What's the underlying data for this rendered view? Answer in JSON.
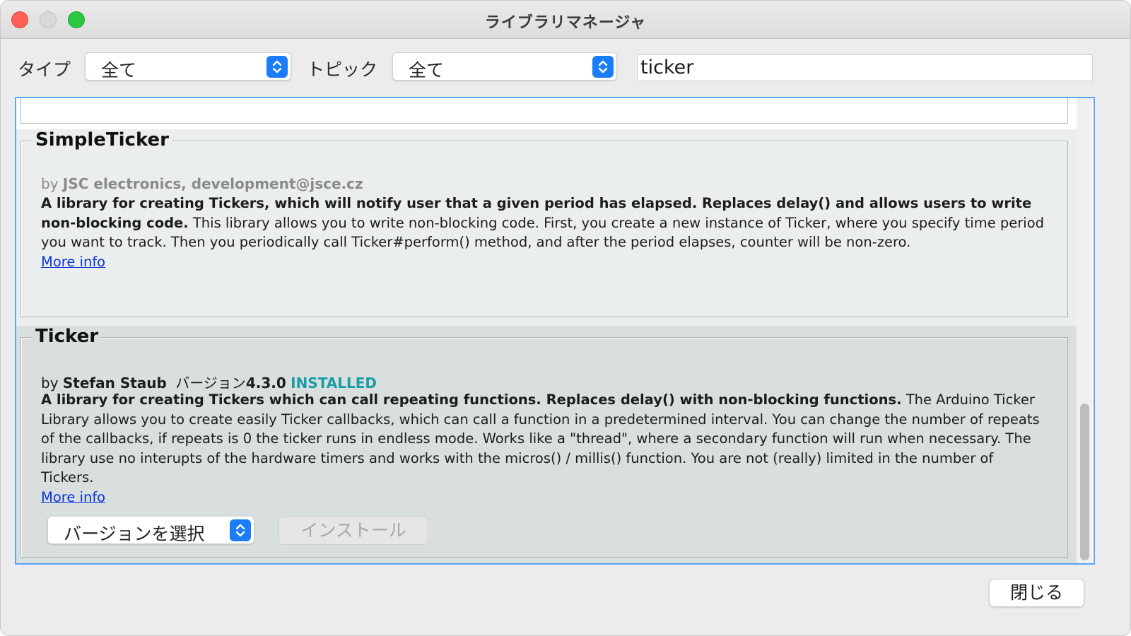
{
  "window": {
    "title": "ライブラリマネージャ"
  },
  "filters": {
    "type_label": "タイプ",
    "type_value": "全て",
    "topic_label": "トピック",
    "topic_value": "全て",
    "search_value": "ticker"
  },
  "libraries": [
    {
      "name": "SimpleTicker",
      "by_prefix": "by",
      "author": "JSC electronics, development@jsce.cz",
      "summary": "A library for creating Tickers, which will notify user that a given period has elapsed. Replaces delay() and allows users to write non-blocking code.",
      "description": "This library allows you to write non-blocking code. First, you create a new instance of Ticker, where you specify time period you want to track. Then you periodically call Ticker#perform() method, and after the period elapses, counter will be non-zero.",
      "more_info": "More info"
    },
    {
      "name": "Ticker",
      "by_prefix": "by",
      "author": "Stefan Staub",
      "version_label": "バージョン",
      "version": "4.3.0",
      "status": "INSTALLED",
      "summary": "A library for creating Tickers which can call repeating functions. Replaces delay() with non-blocking functions.",
      "description": "The Arduino Ticker Library allows you to create easily Ticker callbacks, which can call a function in a predetermined interval. You can change the number of repeats of the callbacks, if repeats is 0 the ticker runs in endless mode. Works like a \"thread\", where a secondary function will run when necessary. The library use no interupts of the hardware timers and works with the micros() / millis() function. You are not (really) limited in the number of Tickers.",
      "more_info": "More info",
      "version_select": "バージョンを選択",
      "install_button": "インストール"
    }
  ],
  "footer": {
    "close_button": "閉じる"
  },
  "colors": {
    "accent": "#1a7cf7",
    "installed": "#1a9da3",
    "link": "#0b33d6",
    "list_border": "#58a6f5"
  },
  "icons": [
    "up-down-stepper-icon"
  ]
}
